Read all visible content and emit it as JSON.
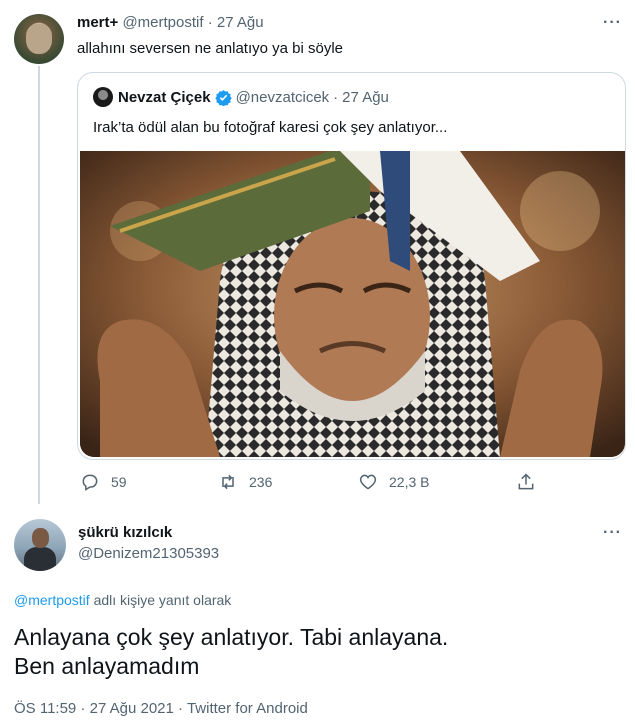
{
  "reply_tweet": {
    "display_name": "mert+",
    "handle": "@mertpostif",
    "separator": "·",
    "date": "27 Ağu",
    "text": "allahını seversen ne anlatıyo ya bi söyle",
    "more_icon": "more-dots-icon"
  },
  "quoted_tweet": {
    "display_name": "Nevzat Çiçek",
    "verified": true,
    "handle": "@nevzatcicek",
    "separator": "·",
    "date": "27 Ağu",
    "text": "Irak’ta ödül alan bu fotoğraf karesi çok şey anlatıyor..."
  },
  "actions": {
    "reply_count": "59",
    "retweet_count": "236",
    "like_count": "22,3 B"
  },
  "main_tweet": {
    "display_name": "şükrü kızılcık",
    "handle": "@Denizem21305393",
    "reply_handle": "@mertpostif",
    "reply_suffix": " adlı kişiye yanıt olarak",
    "text_line1": "Anlayana çok şey anlatıyor. Tabi anlayana.",
    "text_line2": "Ben anlayamadım",
    "time": "ÖS 11:59",
    "separator1": "·",
    "date": "27 Ağu 2021",
    "separator2": "·",
    "source": "Twitter for Android"
  },
  "colors": {
    "accent": "#1d9bf0",
    "secondary_text": "#536471",
    "border": "#cfd9de"
  }
}
